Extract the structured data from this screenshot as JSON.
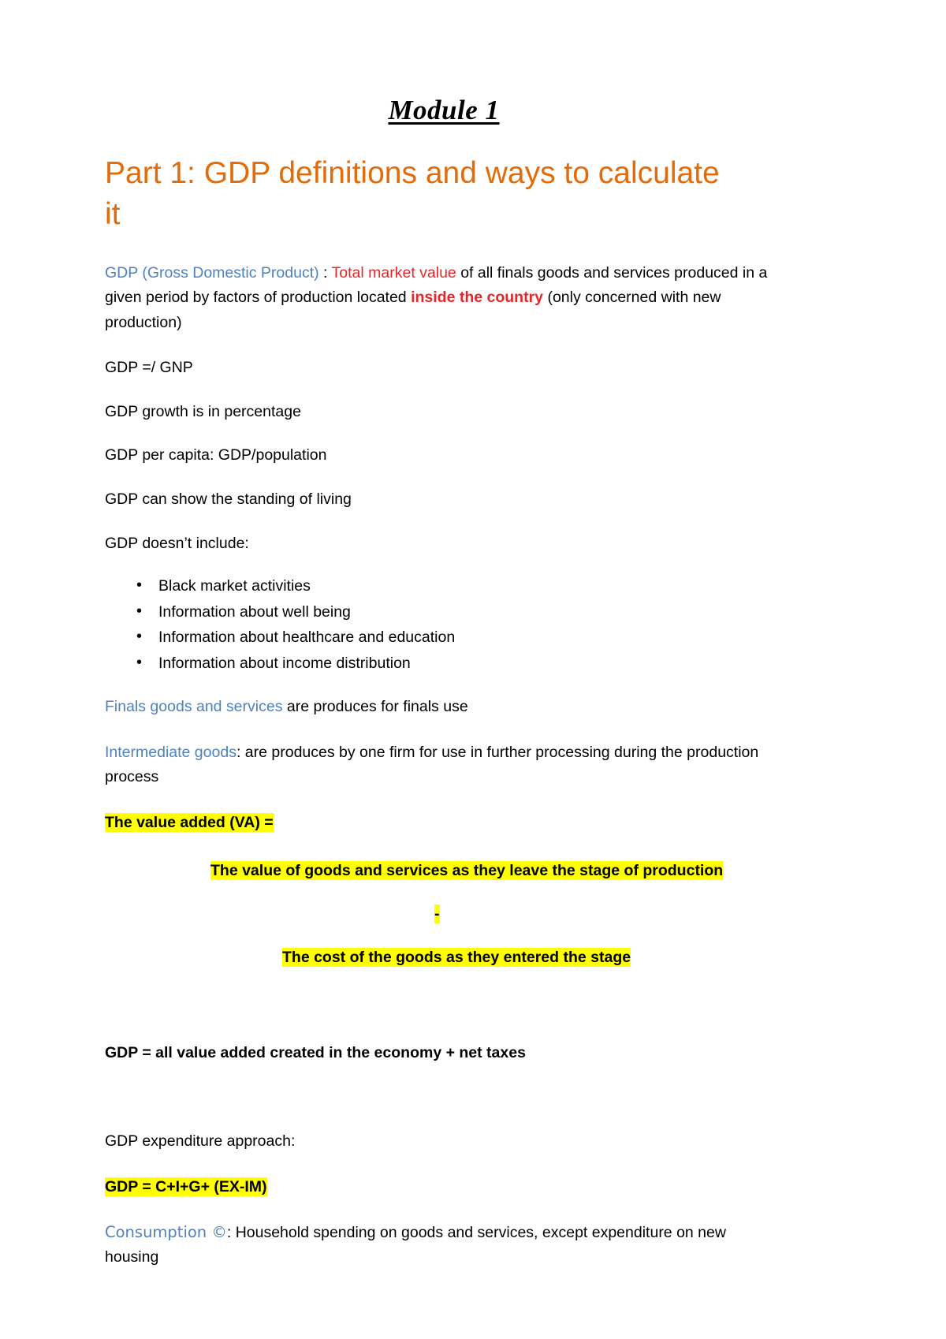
{
  "document": {
    "title": "Module 1",
    "heading": "Part 1: GDP definitions and ways to calculate it",
    "colors": {
      "heading_orange": "#E36C0A",
      "term_blue": "#4F81BD",
      "emphasis_red": "#E8262A",
      "formula_red": "#C00000",
      "highlight_yellow": "#FFFF00"
    }
  },
  "definition": {
    "term": "GDP (Gross Domestic Product)",
    "colon": " : ",
    "emphasis": "Total market value",
    "rest_1": " of all finals goods and services produced in a given period by factors of production located ",
    "emphasis_2": "inside the country",
    "rest_2": " (only concerned with new production)"
  },
  "notes": [
    "GDP =/ GNP",
    "GDP growth is in percentage",
    "GDP per capita: GDP/population",
    "GDP can show the standing of living",
    "GDP doesn’t include:"
  ],
  "exclusions": [
    "Black market activities",
    "Information about well being",
    "Information about healthcare and education",
    "Information about income distribution"
  ],
  "finals_goods": {
    "term": "Finals goods and services",
    "rest": " are produces for finals use"
  },
  "intermediate_goods": {
    "term": "Intermediate goods",
    "rest": ": are produces by one firm for use in further processing during the production process"
  },
  "value_added": {
    "heading": "The value added (VA) =",
    "line_1": "The value of goods and services as they leave the stage of production",
    "operator": "-",
    "line_2": "The cost of the goods as they entered the stage"
  },
  "gdp_value_added_formula": "GDP = all value added created in the economy + net taxes",
  "expenditure": {
    "label": "GDP expenditure approach:",
    "formula": "GDP = C+I+G+ (EX-IM)"
  },
  "consumption": {
    "term": "Consumption ©",
    "rest": ": Household spending on goods and services, except expenditure on new housing"
  }
}
